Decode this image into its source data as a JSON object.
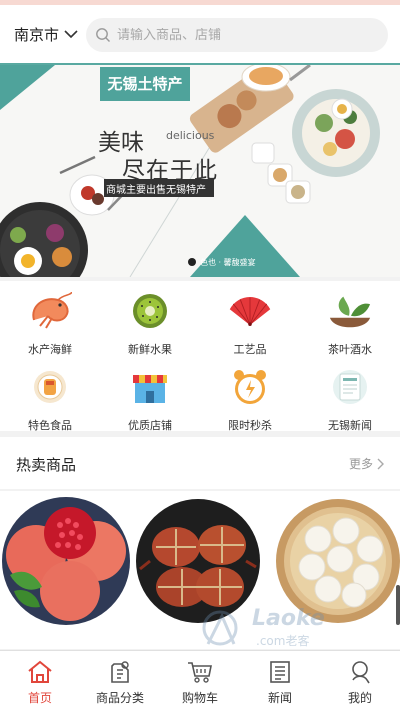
{
  "header": {
    "city": "南京市",
    "search_placeholder": "请输入商品、店铺"
  },
  "banner": {
    "tag": "无锡土特产",
    "headline_1": "美味",
    "headline_en": "delicious",
    "headline_2": "尽在于此",
    "subtitle": "商城主要出售无锡特产",
    "footer_text": "色也 · 馨馥盛宴"
  },
  "categories": [
    {
      "label": "水产海鲜",
      "icon": "shrimp-icon"
    },
    {
      "label": "新鲜水果",
      "icon": "kiwi-icon"
    },
    {
      "label": "工艺品",
      "icon": "fan-icon"
    },
    {
      "label": "茶叶酒水",
      "icon": "tea-icon"
    },
    {
      "label": "特色食品",
      "icon": "food-icon"
    },
    {
      "label": "优质店铺",
      "icon": "shop-icon"
    },
    {
      "label": "限时秒杀",
      "icon": "alarm-clock-icon"
    },
    {
      "label": "无锡新闻",
      "icon": "news-icon"
    }
  ],
  "hot": {
    "title": "热卖商品",
    "more": "更多"
  },
  "watermark": {
    "brand": "Laoke",
    "domain": ".com老客"
  },
  "tabbar": [
    {
      "label": "首页",
      "icon": "home-icon",
      "active": true
    },
    {
      "label": "商品分类",
      "icon": "category-icon",
      "active": false
    },
    {
      "label": "购物车",
      "icon": "cart-icon",
      "active": false
    },
    {
      "label": "新闻",
      "icon": "news-icon",
      "active": false
    },
    {
      "label": "我的",
      "icon": "user-icon",
      "active": false
    }
  ],
  "colors": {
    "accent": "#e1463b",
    "teal": "#4fa39b",
    "search_bg": "#f1f1f1"
  }
}
